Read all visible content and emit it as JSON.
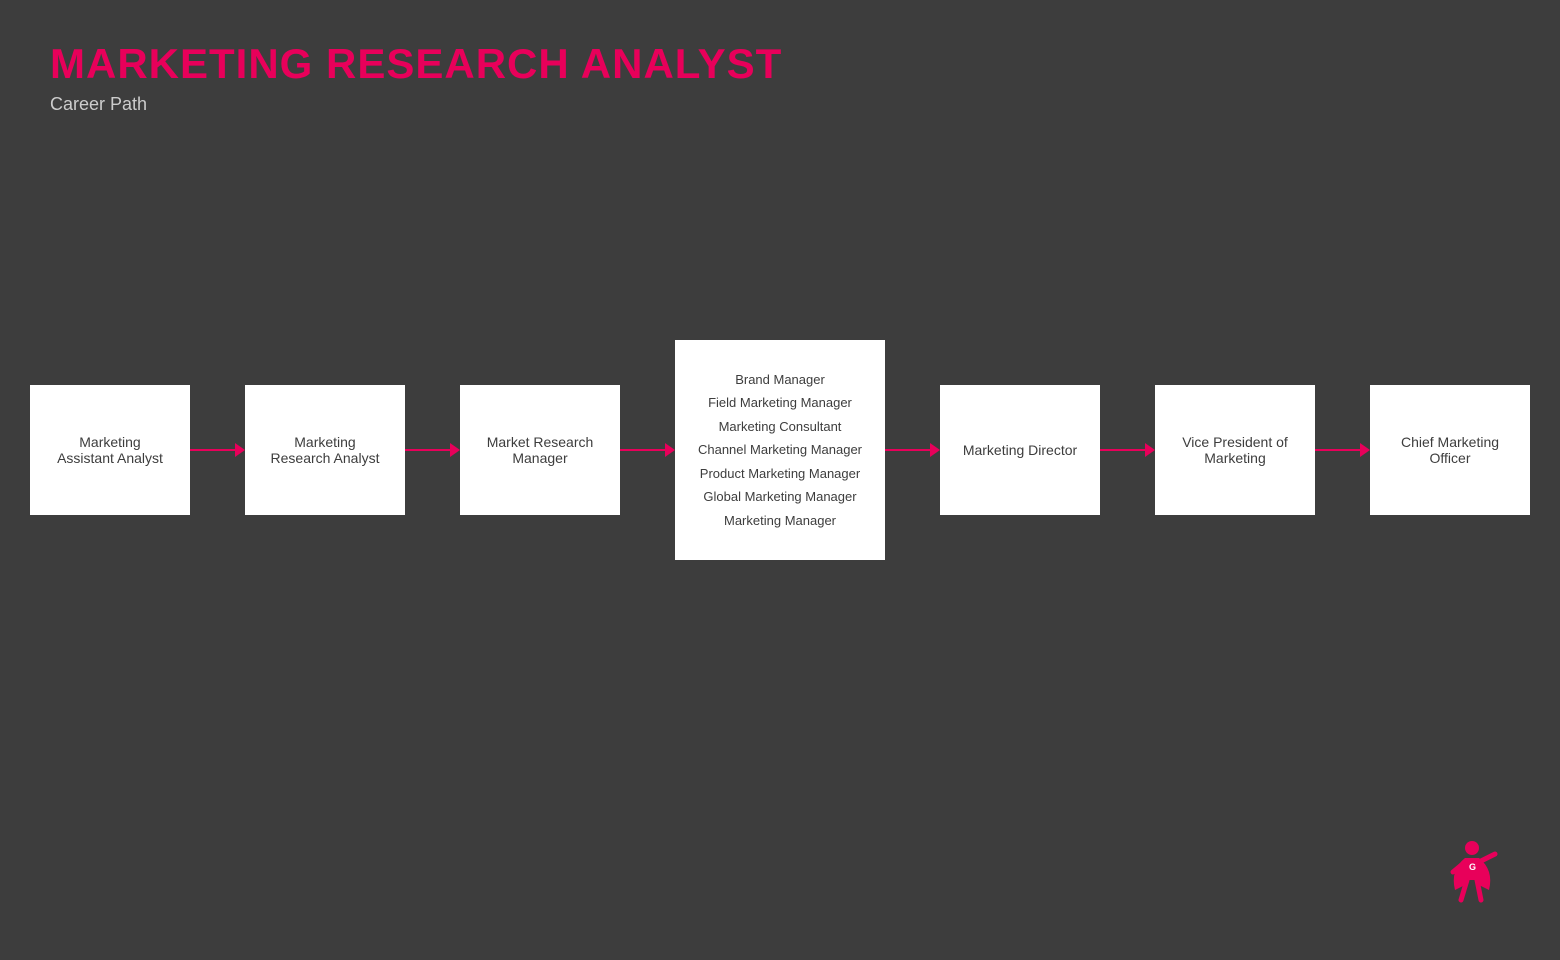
{
  "header": {
    "title": "MARKETING RESEARCH ANALYST",
    "subtitle": "Career Path"
  },
  "career_path": {
    "nodes": [
      {
        "id": "marketing-assistant-analyst",
        "label": "Marketing\nAssistant Analyst",
        "type": "single"
      },
      {
        "id": "marketing-research-analyst",
        "label": "Marketing\nResearch Analyst",
        "type": "single"
      },
      {
        "id": "market-research-manager",
        "label": "Market Research\nManager",
        "type": "single"
      },
      {
        "id": "marketing-manager-group",
        "type": "multi",
        "items": [
          "Brand Manager",
          "Field Marketing Manager",
          "Marketing Consultant",
          "Channel Marketing Manager",
          "Product Marketing Manager",
          "Global Marketing Manager",
          "Marketing Manager"
        ]
      },
      {
        "id": "marketing-director",
        "label": "Marketing Director",
        "type": "single"
      },
      {
        "id": "vice-president-marketing",
        "label": "Vice President of\nMarketing",
        "type": "single"
      },
      {
        "id": "chief-marketing-officer",
        "label": "Chief Marketing\nOfficer",
        "type": "single"
      }
    ]
  },
  "logo": {
    "alt": "Glassdoor superhero logo"
  },
  "colors": {
    "accent": "#e8005a",
    "background": "#3d3d3d",
    "node_bg": "#ffffff",
    "text_dark": "#3d3d3d",
    "text_light": "#cccccc"
  }
}
